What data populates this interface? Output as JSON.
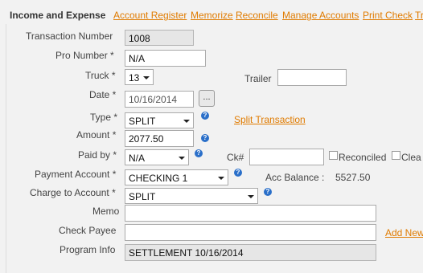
{
  "header": {
    "title": "Income and Expense",
    "links": [
      "Account Register",
      "Memorize",
      "Reconcile",
      "Manage Accounts",
      "Print Check",
      "Tr"
    ]
  },
  "form": {
    "transaction_number": {
      "label": "Transaction Number",
      "value": "1008"
    },
    "pro_number": {
      "label": "Pro Number *",
      "value": "N/A"
    },
    "truck": {
      "label": "Truck *",
      "value": "13"
    },
    "trailer": {
      "label": "Trailer",
      "value": ""
    },
    "date": {
      "label": "Date *",
      "value": "10/16/2014",
      "button": "..."
    },
    "type": {
      "label": "Type *",
      "value": "SPLIT",
      "link": "Split Transaction"
    },
    "amount": {
      "label": "Amount *",
      "value": "2077.50"
    },
    "paid_by": {
      "label": "Paid by *",
      "value": "N/A"
    },
    "check_number": {
      "label": "Ck#",
      "value": ""
    },
    "reconciled": {
      "label": "Reconciled"
    },
    "cleared": {
      "label": "Clea"
    },
    "payment_account": {
      "label": "Payment Account *",
      "value": "CHECKING 1"
    },
    "acc_balance": {
      "label": "Acc Balance :",
      "value": "5527.50"
    },
    "charge_to_account": {
      "label": "Charge to Account *",
      "value": "SPLIT"
    },
    "memo": {
      "label": "Memo",
      "value": ""
    },
    "check_payee": {
      "label": "Check Payee",
      "value": "",
      "link": "Add New"
    },
    "program_info": {
      "label": "Program Info",
      "value": "SETTLEMENT 10/16/2014"
    }
  },
  "help_glyph": "?"
}
